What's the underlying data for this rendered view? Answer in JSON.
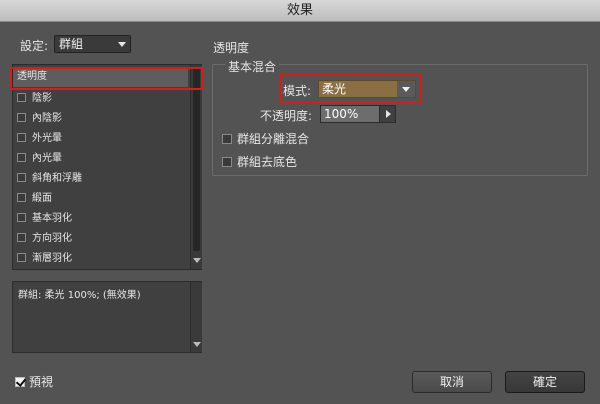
{
  "window": {
    "title": "效果"
  },
  "settings": {
    "label": "設定:",
    "value": "群組"
  },
  "effects_list": {
    "selected": "透明度",
    "items": [
      {
        "label": "陰影"
      },
      {
        "label": "內陰影"
      },
      {
        "label": "外光暈"
      },
      {
        "label": "內光暈"
      },
      {
        "label": "斜角和浮雕"
      },
      {
        "label": "緞面"
      },
      {
        "label": "基本羽化"
      },
      {
        "label": "方向羽化"
      },
      {
        "label": "漸層羽化"
      }
    ]
  },
  "summary": {
    "text": "群組: 柔光 100%; (無效果)"
  },
  "preview": {
    "label": "預視",
    "checked": true
  },
  "panel": {
    "title": "透明度",
    "basic_blend": {
      "legend": "基本混合",
      "mode_label": "模式:",
      "mode_value": "柔光",
      "opacity_label": "不透明度:",
      "opacity_value": "100%",
      "isolate_label": "群組分離混合",
      "knockout_label": "群組去底色"
    }
  },
  "buttons": {
    "cancel": "取消",
    "ok": "確定"
  },
  "colors": {
    "highlight": "#d0201c",
    "background": "#535353",
    "mode_field": "#8a6f44"
  }
}
